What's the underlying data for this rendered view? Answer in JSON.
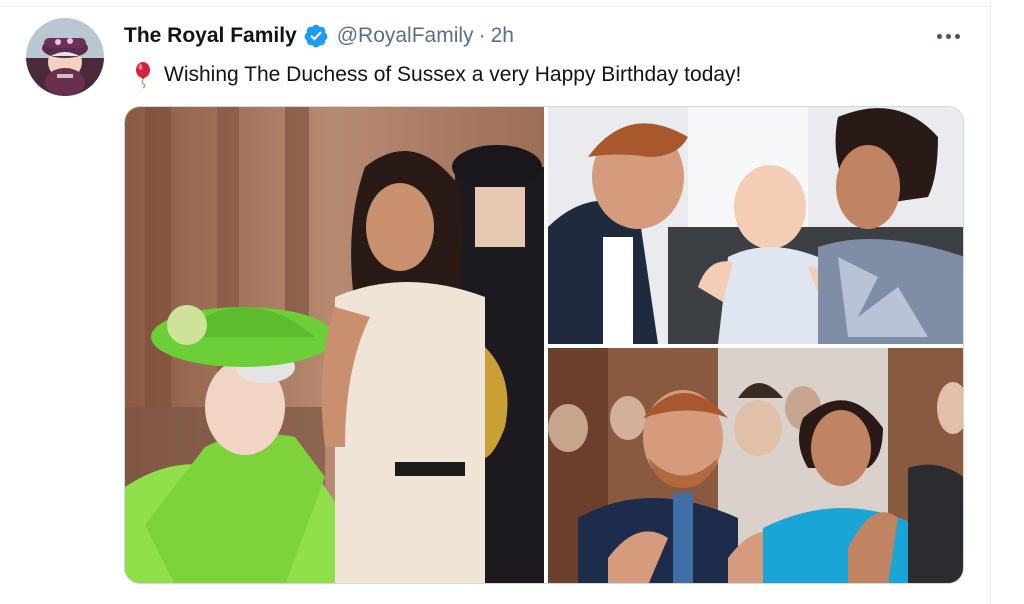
{
  "tweet": {
    "display_name": "The Royal Family",
    "handle": "@RoyalFamily",
    "separator": "·",
    "timestamp": "2h",
    "text": "Wishing The Duchess of Sussex a very Happy Birthday today!",
    "icons": {
      "avatar": "profile-avatar",
      "verified": "verified-badge-icon",
      "emoji": "balloon-icon",
      "more": "more-options-icon"
    },
    "colors": {
      "verified_blue": "#1d9bf0",
      "handle_gray": "#5b7083",
      "balloon_red": "#d4213d"
    },
    "media": {
      "photo_count": 3,
      "photos": [
        {
          "subject": "queen-and-duchess-outdoors"
        },
        {
          "subject": "couple-with-baby"
        },
        {
          "subject": "couple-applauding-in-audience"
        }
      ]
    }
  }
}
